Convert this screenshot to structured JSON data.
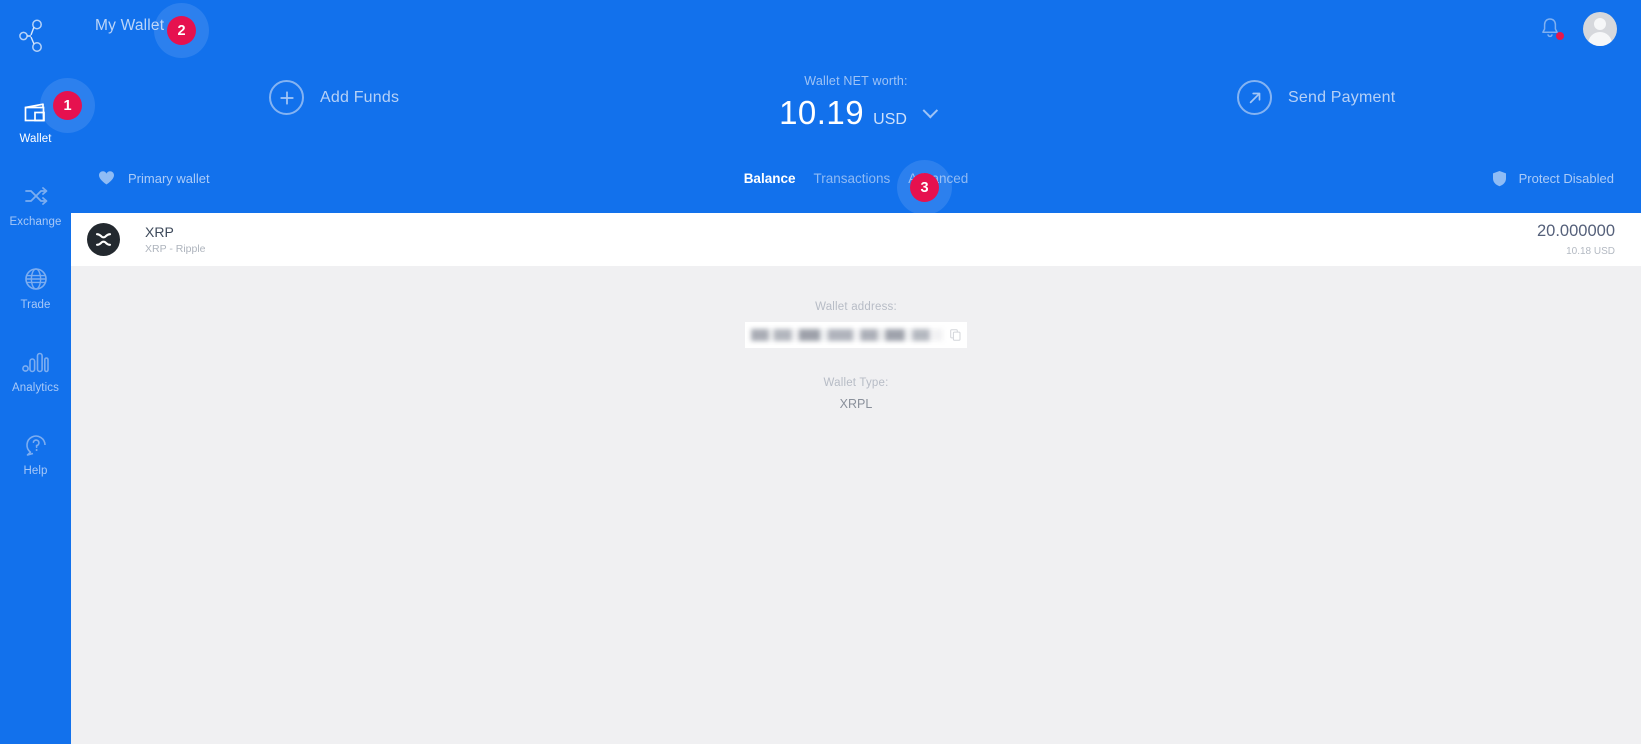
{
  "brand": {
    "logo_icon": "network-nodes-icon"
  },
  "sidebar": {
    "items": [
      {
        "label": "Wallet",
        "icon": "wallet-icon",
        "active": true
      },
      {
        "label": "Exchange",
        "icon": "exchange-icon",
        "active": false
      },
      {
        "label": "Trade",
        "icon": "globe-icon",
        "active": false
      },
      {
        "label": "Analytics",
        "icon": "bar-chart-icon",
        "active": false
      },
      {
        "label": "Help",
        "icon": "help-circle-icon",
        "active": false
      }
    ]
  },
  "topbar": {
    "wallet_selector_label": "My Wallet",
    "chevron_icon": "chevron-down-icon",
    "notification_icon": "bell-icon",
    "avatar_icon": "user-avatar-icon"
  },
  "hero": {
    "add_funds_label": "Add Funds",
    "add_funds_icon": "plus-circle-icon",
    "send_payment_label": "Send Payment",
    "send_payment_icon": "arrow-up-right-circle-icon",
    "networth_label": "Wallet NET worth:",
    "networth_amount": "10.19",
    "networth_currency": "USD",
    "networth_chevron_icon": "chevron-down-icon"
  },
  "subbar": {
    "primary_wallet_label": "Primary wallet",
    "primary_wallet_icon": "heart-icon",
    "protect_label": "Protect Disabled",
    "protect_icon": "shield-icon",
    "tabs": [
      {
        "label": "Balance",
        "active": true
      },
      {
        "label": "Transactions",
        "active": false
      },
      {
        "label": "Advanced",
        "active": false
      }
    ]
  },
  "badges": [
    {
      "number": "1",
      "color": "#e6114f"
    },
    {
      "number": "2",
      "color": "#e6114f"
    },
    {
      "number": "3",
      "color": "#e6114f"
    }
  ],
  "asset_row": {
    "coin_icon": "xrp-coin-icon",
    "symbol": "XRP",
    "full_name": "XRP - Ripple",
    "quantity": "20.000000",
    "fiat_value": "10.18 USD"
  },
  "detail": {
    "address_label": "Wallet address:",
    "address_value": "",
    "address_redacted": true,
    "copy_icon": "copy-icon",
    "wallet_type_label": "Wallet Type:",
    "wallet_type_value": "XRPL"
  },
  "colors": {
    "brand_blue": "#1271ec",
    "badge_red": "#e6114f",
    "panel_gray": "#f0f0f2",
    "coin_dark": "#23292f"
  }
}
